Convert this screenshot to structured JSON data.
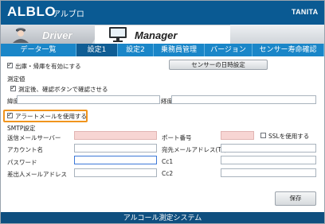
{
  "app": {
    "title": "ALBLO",
    "subtitle": "アルブロ",
    "brand": "TANITA"
  },
  "modes": {
    "driver": "Driver",
    "manager": "Manager"
  },
  "tabs": [
    "データ一覧",
    "設定1",
    "設定2",
    "乗務員管理",
    "バージョン",
    "センサー寿命確認"
  ],
  "active_tab": "設定1",
  "settings": {
    "checkin_checkout_label": "出庫・帰庫を有効にする",
    "sensor_datetime_button": "センサーの日時設定",
    "measurement_value_label": "測定値",
    "measure_confirm_label": "測定後、確認ボタンで確認させる",
    "latitude_label": "緯度",
    "longitude_label": "経度",
    "alert_mail_label": "アラートメールを使用する",
    "smtp_label": "SMTP設定",
    "smtp_server_label": "送信メールサーバー",
    "port_label": "ポート番号",
    "ssl_label": "SSLを使用する",
    "account_label": "アカウント名",
    "to_address_label": "宛先メールアドレス(To)",
    "password_label": "パスワード",
    "cc1_label": "Cc1",
    "from_address_label": "差出人メールアドレス",
    "cc2_label": "Cc2",
    "save_button": "保存"
  },
  "footer": {
    "text": "アルコール測定システム"
  },
  "colors": {
    "header": "#0a5a93",
    "tabs": "#1a86c8",
    "active_tab": "#0f5d94",
    "highlight": "#f0941d",
    "footer": "#0f4f7f"
  }
}
